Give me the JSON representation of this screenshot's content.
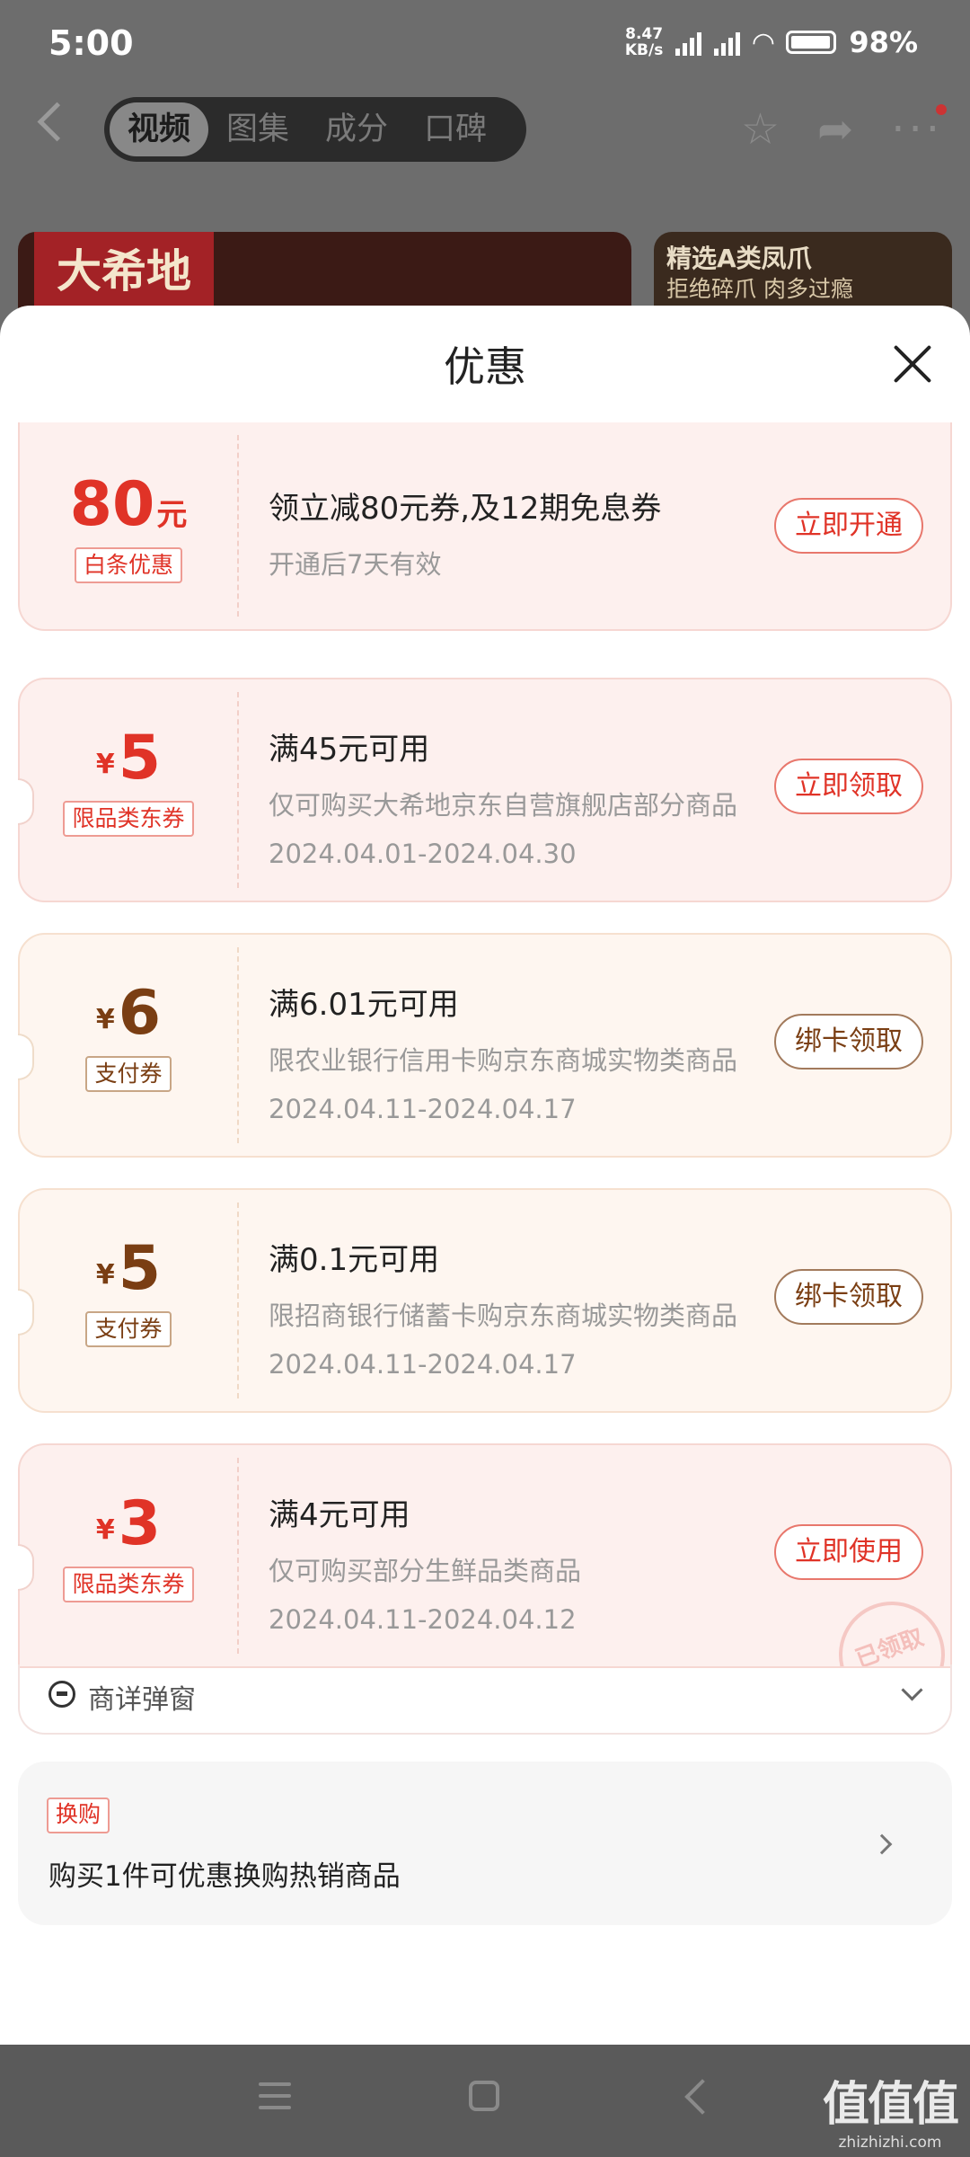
{
  "status_bar": {
    "time": "5:00",
    "speed_top": "8.47",
    "speed_unit": "KB/s",
    "battery": "98%"
  },
  "product_nav": {
    "tabs": [
      {
        "label": "视频",
        "active": true
      },
      {
        "label": "图集"
      },
      {
        "label": "成分"
      },
      {
        "label": "口碑"
      }
    ]
  },
  "banners": {
    "left_brand": "大希地",
    "right_line1": "精选A类凤爪",
    "right_line2": "拒绝碎爪 肉多过瘾"
  },
  "sheet": {
    "title": "优惠",
    "coupons": [
      {
        "style": "red",
        "yen": "",
        "amount": "80",
        "unit": "元",
        "tag": "白条优惠",
        "title": "领立减80元券,及12期免息券",
        "desc": "开通后7天有效",
        "date": "",
        "button": "立即开通",
        "stamp": ""
      },
      {
        "style": "red",
        "yen": "¥",
        "amount": "5",
        "unit": "",
        "tag": "限品类东券",
        "title": "满45元可用",
        "desc": "仅可购买大希地京东自营旗舰店部分商品",
        "date": "2024.04.01-2024.04.30",
        "button": "立即领取",
        "stamp": ""
      },
      {
        "style": "gold",
        "yen": "¥",
        "amount": "6",
        "unit": "",
        "tag": "支付券",
        "title": "满6.01元可用",
        "desc": "限农业银行信用卡购京东商城实物类商品",
        "date": "2024.04.11-2024.04.17",
        "button": "绑卡领取",
        "stamp": ""
      },
      {
        "style": "gold",
        "yen": "¥",
        "amount": "5",
        "unit": "",
        "tag": "支付券",
        "title": "满0.1元可用",
        "desc": "限招商银行储蓄卡购京东商城实物类商品",
        "date": "2024.04.11-2024.04.17",
        "button": "绑卡领取",
        "stamp": ""
      },
      {
        "style": "red",
        "yen": "¥",
        "amount": "3",
        "unit": "",
        "tag": "限品类东券",
        "title": "满4元可用",
        "desc": "仅可购买部分生鲜品类商品",
        "date": "2024.04.11-2024.04.12",
        "button": "立即使用",
        "stamp": "已领取"
      }
    ],
    "popup_footer_label": "商详弹窗",
    "swap": {
      "badge": "换购",
      "text": "购买1件可优惠换购热销商品"
    }
  },
  "watermark": {
    "logo": "值值值",
    "site": "zhizhizhi.com"
  }
}
